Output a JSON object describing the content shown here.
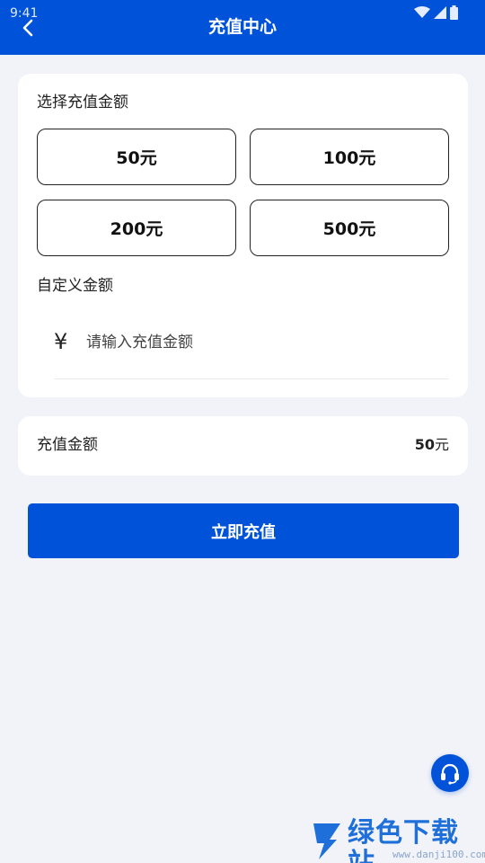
{
  "status_bar": {
    "time": "9:41"
  },
  "header": {
    "title": "充值中心"
  },
  "amount_section": {
    "label": "选择充值金额",
    "options": [
      "50元",
      "100元",
      "200元",
      "500元"
    ]
  },
  "custom_section": {
    "label": "自定义金额",
    "currency_symbol": "¥",
    "placeholder": "请输入充值金额",
    "value": ""
  },
  "summary": {
    "label": "充值金额",
    "amount": "50",
    "unit": "元"
  },
  "submit": {
    "label": "立即充值"
  },
  "watermark": {
    "text": "绿色下载站",
    "url": "www.danji100.com"
  },
  "colors": {
    "primary": "#0052d9",
    "background": "#f2f3f8",
    "card": "#ffffff"
  },
  "icons": {
    "back": "chevron-left-icon",
    "support": "headset-icon",
    "wifi": "wifi-icon",
    "signal": "signal-icon",
    "battery": "battery-icon"
  }
}
